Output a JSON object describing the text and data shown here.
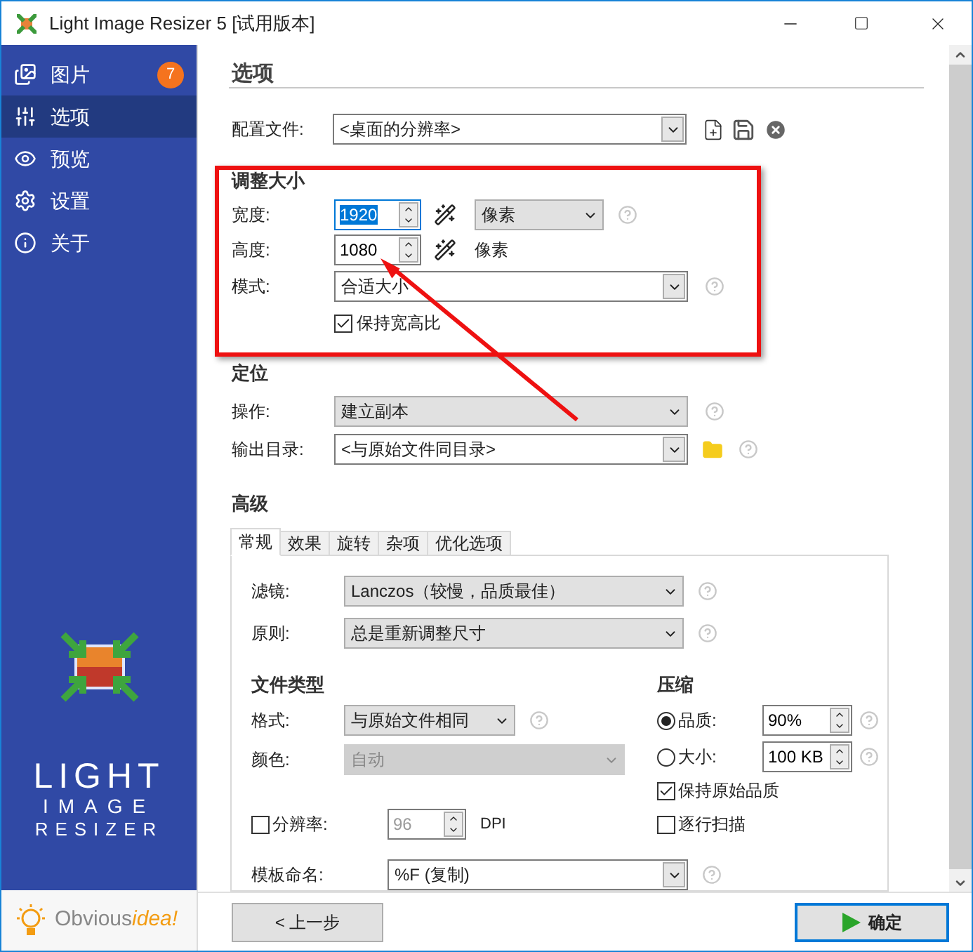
{
  "window": {
    "title": "Light Image Resizer 5  [试用版本]"
  },
  "sidebar": {
    "items": [
      {
        "label": "图片",
        "selected": false,
        "badge": "7"
      },
      {
        "label": "选项",
        "selected": true
      },
      {
        "label": "预览",
        "selected": false
      },
      {
        "label": "设置",
        "selected": false
      },
      {
        "label": "关于",
        "selected": false
      }
    ],
    "logo": {
      "lines": [
        "LIGHT",
        "IMAGE",
        "RESIZER"
      ]
    },
    "brand": {
      "first": "Obvious",
      "second": "idea!"
    }
  },
  "page": {
    "title": "选项",
    "profile": {
      "label": "配置文件:",
      "value": "<桌面的分辨率>"
    },
    "resize": {
      "title": "调整大小",
      "width": {
        "label": "宽度:",
        "value": "1920",
        "selected": true,
        "unit": "像素"
      },
      "height": {
        "label": "高度:",
        "value": "1080",
        "selected": false,
        "unit": "像素"
      },
      "mode": {
        "label": "模式:",
        "value": "合适大小"
      },
      "keep_ratio": {
        "label": "保持宽高比",
        "checked": true
      }
    },
    "position": {
      "title": "定位",
      "action": {
        "label": "操作:",
        "value": "建立副本"
      },
      "output": {
        "label": "输出目录:",
        "value": "<与原始文件同目录>"
      }
    },
    "advanced": {
      "title": "高级",
      "tabs": [
        {
          "label": "常规",
          "selected": true
        },
        {
          "label": "效果",
          "selected": false
        },
        {
          "label": "旋转",
          "selected": false
        },
        {
          "label": "杂项",
          "selected": false
        },
        {
          "label": "优化选项",
          "selected": false
        }
      ],
      "filter": {
        "label": "滤镜:",
        "value": "Lanczos（较慢，品质最佳）"
      },
      "rule": {
        "label": "原则:",
        "value": "总是重新调整尺寸"
      },
      "file_type": {
        "title": "文件类型",
        "format": {
          "label": "格式:",
          "value": "与原始文件相同"
        },
        "color": {
          "label": "颜色:",
          "value": "自动",
          "disabled": true
        },
        "resolution": {
          "label": "分辨率:",
          "checked": false,
          "value": "96",
          "unit": "DPI"
        },
        "template": {
          "label": "模板命名:",
          "value": "%F (复制)"
        }
      },
      "compression": {
        "title": "压缩",
        "options": [
          {
            "label": "品质:",
            "selected": true,
            "value": "90%"
          },
          {
            "label": "大小:",
            "selected": false,
            "value": "100 KB"
          }
        ],
        "checks": [
          {
            "label": "保持原始品质",
            "checked": true
          },
          {
            "label": "逐行扫描",
            "checked": false
          }
        ]
      }
    }
  },
  "footer": {
    "back": "< 上一步",
    "ok": "确定"
  }
}
